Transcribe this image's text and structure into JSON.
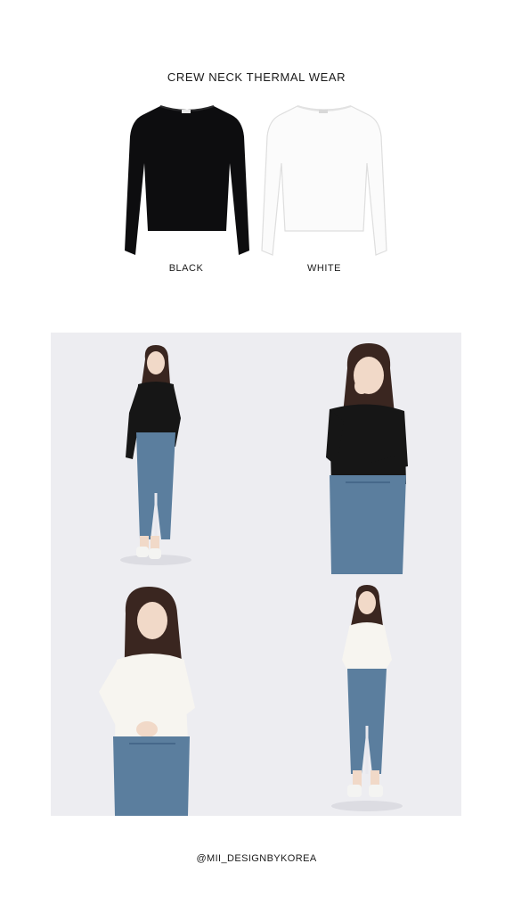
{
  "product": {
    "title": "CREW NECK THERMAL WEAR",
    "colors": [
      {
        "label": "BLACK",
        "swatch": "#0d0d0f"
      },
      {
        "label": "WHITE",
        "swatch": "#fbfbfb"
      }
    ]
  },
  "gallery": {
    "background": "#ededf1",
    "photos": [
      {
        "top_color": "#161616",
        "skirt_color": "#5b7e9e"
      },
      {
        "top_color": "#161616",
        "skirt_color": "#5b7e9e"
      },
      {
        "top_color": "#f7f5f0",
        "skirt_color": "#5b7e9e"
      },
      {
        "top_color": "#f7f5f0",
        "skirt_color": "#5b7e9e"
      }
    ]
  },
  "footer": {
    "handle": "@MII_DESIGNBYKOREA"
  }
}
